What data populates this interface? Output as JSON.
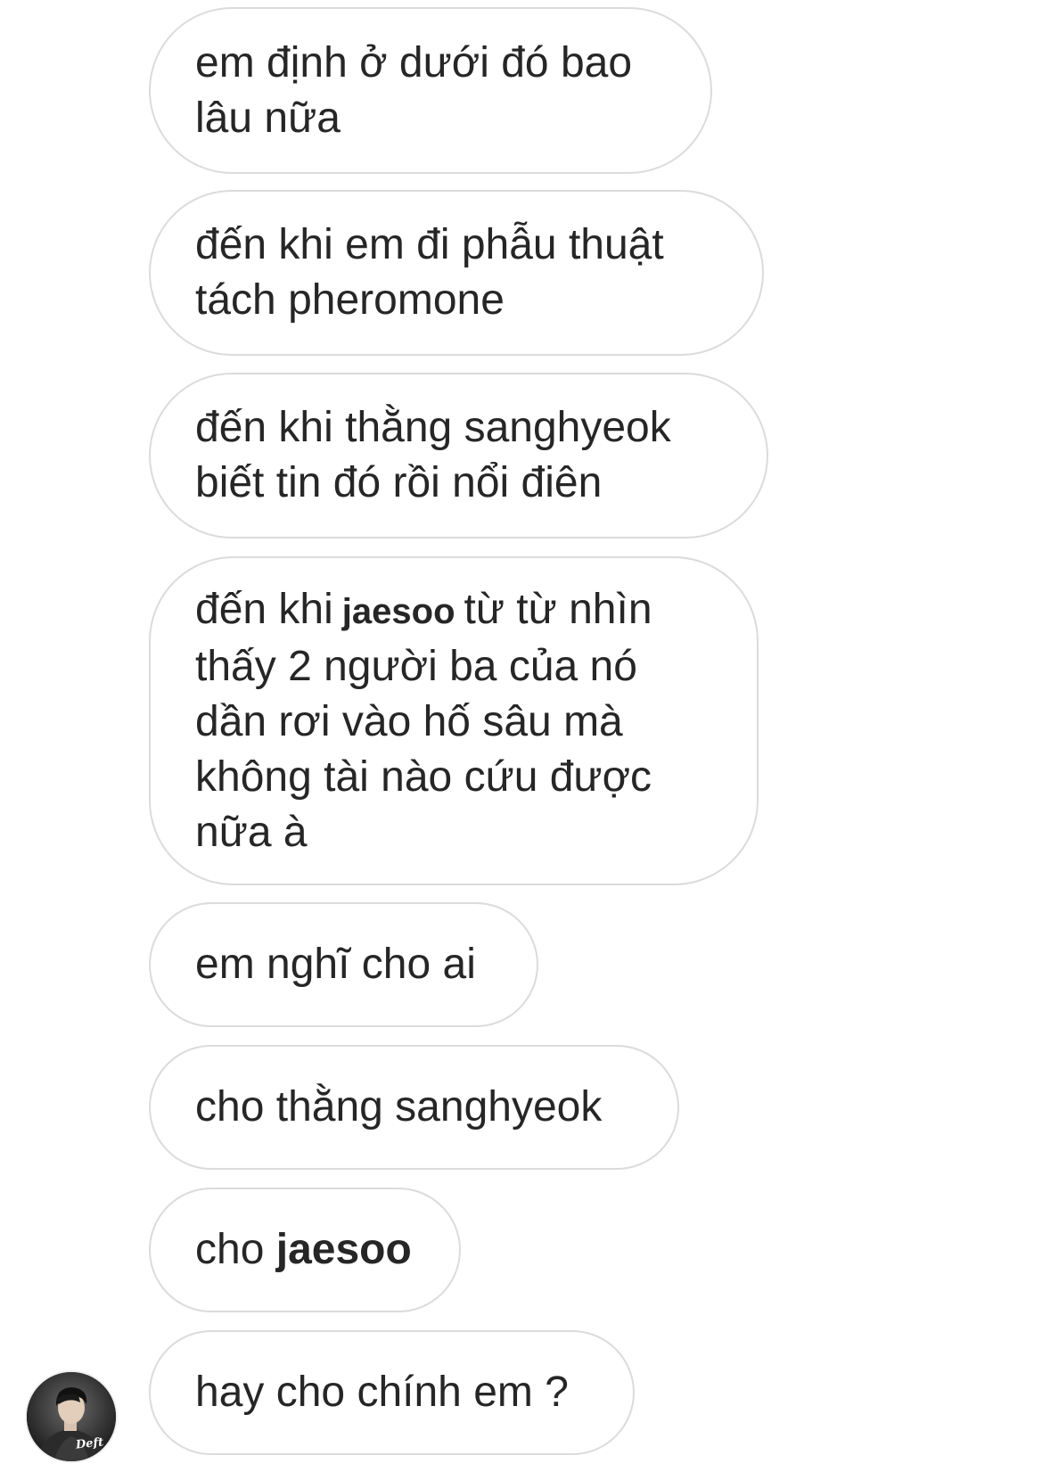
{
  "messages": [
    {
      "lines": [
        "em định ở dưới đó bao",
        "lâu nữa"
      ]
    },
    {
      "lines": [
        "đến khi em đi phẫu thuật",
        "tách pheromone"
      ]
    },
    {
      "lines": [
        "đến khi thằng sanghyeok",
        "biết tin đó rồi nổi điên"
      ]
    },
    {
      "line1_before": "đến khi",
      "line1_mention": "jaesoo",
      "line1_after": "từ từ nhìn",
      "lines_rest": [
        "thấy 2 người ba của nó",
        "dần rơi vào hố sâu mà",
        "không tài nào cứu được",
        "nữa à"
      ]
    },
    {
      "lines": [
        "em nghĩ cho ai"
      ]
    },
    {
      "lines": [
        "cho thằng sanghyeok"
      ]
    },
    {
      "before": "cho",
      "mention": "jaesoo"
    },
    {
      "lines": [
        "hay cho chính em ?"
      ]
    }
  ],
  "avatar": {
    "caption": "Deft"
  },
  "colors": {
    "bubble_border": "#dbdbdb",
    "text": "#262626",
    "background": "#ffffff"
  }
}
